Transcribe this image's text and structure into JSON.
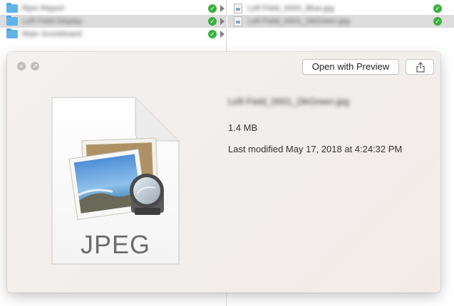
{
  "finder": {
    "left_column": [
      {
        "name": "Rpm Report",
        "selected": false
      },
      {
        "name": "Left Field Display",
        "selected": true
      },
      {
        "name": "Main Scoreboard",
        "selected": false
      }
    ],
    "right_column": [
      {
        "name": "Left Field_0000_Blue.jpg",
        "selected": false
      },
      {
        "name": "Left Field_0001_DkGreen.jpg",
        "selected": true
      }
    ]
  },
  "quicklook": {
    "open_button_label": "Open with Preview",
    "share_icon": "share-icon",
    "close_icon": "close-icon",
    "fullscreen_icon": "fullscreen-icon",
    "file_type_label": "JPEG",
    "file_name": "Left Field_0001_DkGreen.jpg",
    "file_size": "1.4 MB",
    "last_modified": "Last modified May 17, 2018 at 4:24:32 PM"
  },
  "colors": {
    "status_green": "#3ab13d",
    "folder_blue": "#5fb3ea",
    "selection_gray": "#dcdcdc"
  }
}
